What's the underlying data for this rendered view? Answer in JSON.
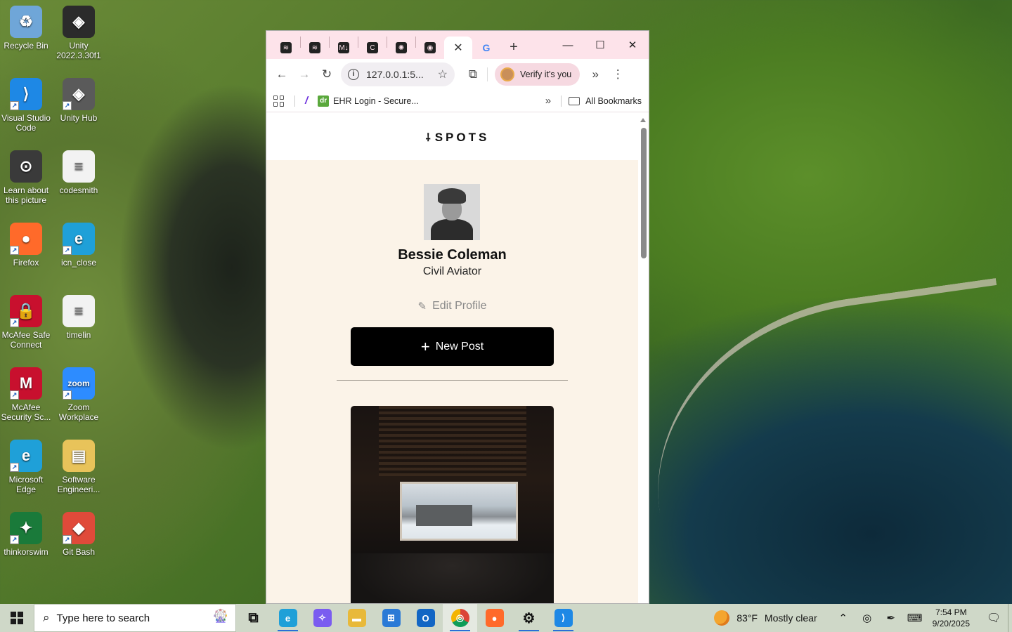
{
  "desktop": {
    "icons": [
      {
        "label": "Recycle Bin",
        "icon": "recycle-bin-icon",
        "color": "#6fa6d8",
        "glyph": "♻"
      },
      {
        "label": "Unity 2022.3.30f1",
        "icon": "unity-icon",
        "color": "#2b2b2b",
        "glyph": "◈"
      },
      {
        "label": "Visual Studio Code",
        "icon": "vscode-icon",
        "color": "#1e88e5",
        "glyph": "⟩"
      },
      {
        "label": "Unity Hub",
        "icon": "unity-hub-icon",
        "color": "#5a5a5a",
        "glyph": "◈"
      },
      {
        "label": "Learn about this picture",
        "icon": "camera-icon",
        "color": "#3a3a3a",
        "glyph": "⊙"
      },
      {
        "label": "codesmith",
        "icon": "text-file-icon",
        "color": "#f2f2f2",
        "glyph": "≡"
      },
      {
        "label": "Firefox",
        "icon": "firefox-icon",
        "color": "#ff6a2a",
        "glyph": "●"
      },
      {
        "label": "icn_close",
        "icon": "edge-icon",
        "color": "#1fa0d8",
        "glyph": "e"
      },
      {
        "label": "McAfee Safe Connect",
        "icon": "mcafee-safe-icon",
        "color": "#c8102e",
        "glyph": "🔒"
      },
      {
        "label": "timelin",
        "icon": "text-file-icon",
        "color": "#f2f2f2",
        "glyph": "≡"
      },
      {
        "label": "McAfee Security Sc...",
        "icon": "mcafee-icon",
        "color": "#c8102e",
        "glyph": "M"
      },
      {
        "label": "Zoom Workplace",
        "icon": "zoom-icon",
        "color": "#2d8cff",
        "glyph": "zoom"
      },
      {
        "label": "Microsoft Edge",
        "icon": "edge-icon",
        "color": "#1fa0d8",
        "glyph": "e"
      },
      {
        "label": "Software Engineeri...",
        "icon": "folder-icon",
        "color": "#e8c35a",
        "glyph": "▤"
      },
      {
        "label": "thinkorswim",
        "icon": "thinkorswim-icon",
        "color": "#1a7a3a",
        "glyph": "✦"
      },
      {
        "label": "Git Bash",
        "icon": "git-bash-icon",
        "color": "#e04a3a",
        "glyph": "◆"
      }
    ]
  },
  "browser": {
    "tabs": [
      {
        "icon": "tab-app-icon-1",
        "glyph": "≋"
      },
      {
        "icon": "tab-app-icon-2",
        "glyph": "≋"
      },
      {
        "icon": "markdown-icon",
        "glyph": "M↓"
      },
      {
        "icon": "doc-icon",
        "glyph": "C"
      },
      {
        "icon": "openai-icon",
        "glyph": "✺"
      },
      {
        "icon": "github-icon",
        "glyph": "◉"
      },
      {
        "icon": "close-icon",
        "glyph": "✕",
        "active": true
      },
      {
        "icon": "google-icon",
        "glyph": "G"
      }
    ],
    "new_tab": "+",
    "window_controls": {
      "minimize": "—",
      "maximize": "☐",
      "close": "✕"
    },
    "toolbar": {
      "back": "←",
      "forward": "→",
      "reload": "↻",
      "url": "127.0.0.1:5...",
      "star": "☆",
      "extensions": "⧉",
      "verify_label": "Verify it's you",
      "more_chevrons": "»",
      "menu": "⋮"
    },
    "bookmarks": {
      "items": [
        {
          "label": "EHR Login - Secure...",
          "favicon": "dr"
        }
      ],
      "more": "»",
      "all_bookmarks": "All Bookmarks"
    }
  },
  "page": {
    "logo_text": "SPOTS",
    "logo_mark": "⸸",
    "profile": {
      "name": "Bessie Coleman",
      "role": "Civil Aviator"
    },
    "edit_profile_label": "Edit Profile",
    "new_post_label": "New Post"
  },
  "taskbar": {
    "search_placeholder": "Type here to search",
    "apps": [
      {
        "icon": "task-view-icon",
        "glyph": "⧉",
        "color": "transparent",
        "fg": "#111"
      },
      {
        "icon": "edge-icon",
        "glyph": "e",
        "color": "#1fa0d8",
        "running": true
      },
      {
        "icon": "copilot-icon",
        "glyph": "✧",
        "color": "#7a5cf0"
      },
      {
        "icon": "file-explorer-icon",
        "glyph": "▬",
        "color": "#e8b93a"
      },
      {
        "icon": "microsoft-store-icon",
        "glyph": "⊞",
        "color": "#2a7ad6"
      },
      {
        "icon": "outlook-icon",
        "glyph": "O",
        "color": "#1266c4"
      },
      {
        "icon": "chrome-icon",
        "glyph": "◎",
        "color": "#db4437",
        "running": true,
        "active": true
      },
      {
        "icon": "firefox-icon",
        "glyph": "●",
        "color": "#ff6a2a"
      },
      {
        "icon": "settings-icon",
        "glyph": "⚙",
        "color": "transparent",
        "fg": "#111",
        "running": true
      },
      {
        "icon": "vscode-icon",
        "glyph": "⟩",
        "color": "#1e88e5",
        "running": true
      }
    ],
    "weather": {
      "temp": "83°F",
      "condition": "Mostly clear"
    },
    "time": "7:54 PM",
    "date": "9/20/2025"
  }
}
